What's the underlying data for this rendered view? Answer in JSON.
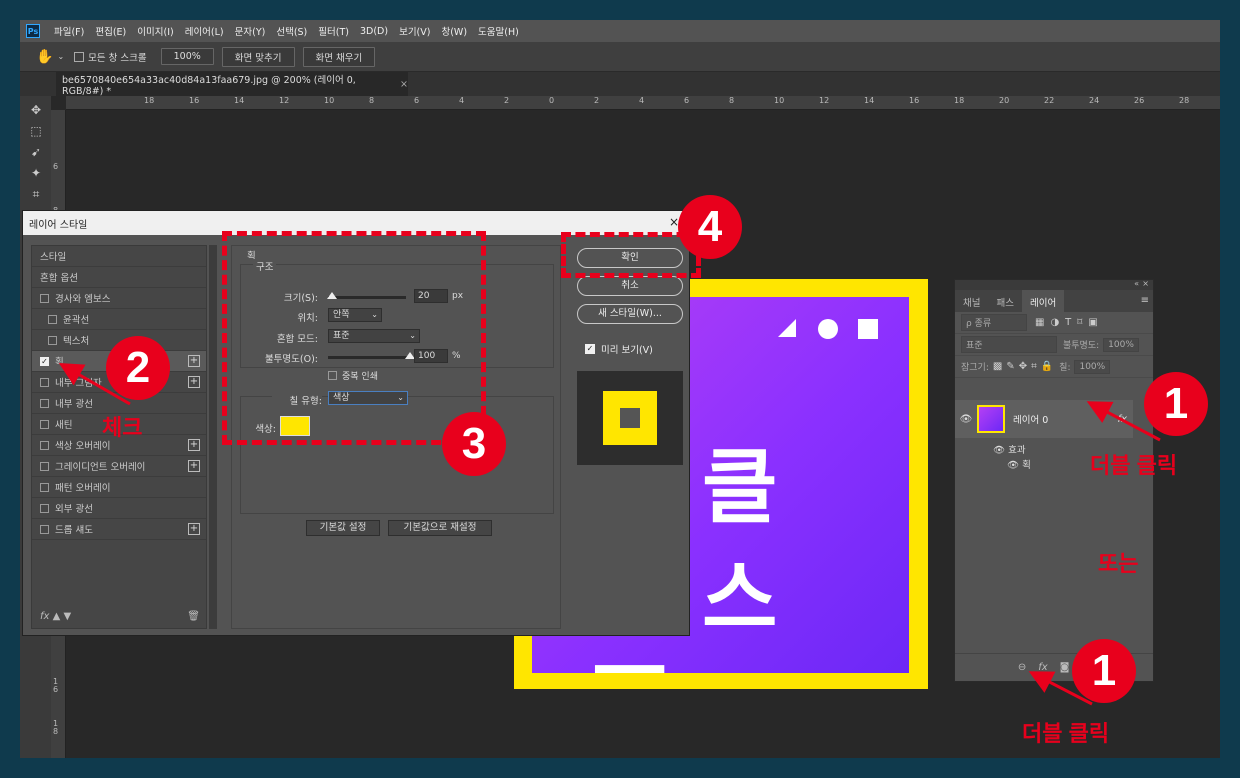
{
  "menu": {
    "logo": "Ps",
    "items": [
      "파일(F)",
      "편집(E)",
      "이미지(I)",
      "레이어(L)",
      "문자(Y)",
      "선택(S)",
      "필터(T)",
      "3D(D)",
      "보기(V)",
      "창(W)",
      "도움말(H)"
    ]
  },
  "options": {
    "scroll_all_label": "모든 창 스크롤",
    "zoom_btn": "100%",
    "fit_screen_btn": "화면 맞추기",
    "fill_screen_btn": "화면 채우기"
  },
  "document": {
    "tab_title": "be6570840e654a33ac40d84a13faa679.jpg @ 200% (레이어 0, RGB/8#) *",
    "close": "×"
  },
  "rulers": {
    "top": [
      "18",
      "16",
      "14",
      "12",
      "10",
      "8",
      "6",
      "4",
      "2",
      "0",
      "2",
      "4",
      "6",
      "8",
      "10",
      "12",
      "14",
      "16",
      "18",
      "20",
      "22",
      "24",
      "26",
      "28",
      "30"
    ],
    "left": [
      "6",
      "8",
      "1\n6",
      "1\n8"
    ]
  },
  "poster": {
    "line1": "클",
    "line2": "스",
    "line3": "ㅠ"
  },
  "layers_panel": {
    "tabs": [
      "채널",
      "패스",
      "레이어"
    ],
    "kind_filter": "ρ 종류",
    "blend_mode": "표준",
    "opacity_label": "불투명도:",
    "opacity_value": "100%",
    "lock_label": "잠그기:",
    "fill_label": "칠:",
    "fill_value": "100%",
    "layer_name": "레이어 0",
    "fx": "fx",
    "effects_label": "효과",
    "stroke_label": "획"
  },
  "dialog": {
    "title": "레이어 스타일",
    "close": "×",
    "styles": [
      {
        "label": "스타일",
        "checkbox": false,
        "plus": false,
        "indent": false,
        "active": false,
        "checked": false
      },
      {
        "label": "혼합 옵션",
        "checkbox": false,
        "plus": false,
        "indent": false,
        "active": false,
        "checked": false
      },
      {
        "label": "경사와 엠보스",
        "checkbox": true,
        "plus": false,
        "indent": false,
        "active": false,
        "checked": false
      },
      {
        "label": "윤곽선",
        "checkbox": true,
        "plus": false,
        "indent": true,
        "active": false,
        "checked": false
      },
      {
        "label": "텍스처",
        "checkbox": true,
        "plus": false,
        "indent": true,
        "active": false,
        "checked": false
      },
      {
        "label": "획",
        "checkbox": true,
        "plus": true,
        "indent": false,
        "active": true,
        "checked": true
      },
      {
        "label": "내부 그림자",
        "checkbox": true,
        "plus": true,
        "indent": false,
        "active": false,
        "checked": false
      },
      {
        "label": "내부 광선",
        "checkbox": true,
        "plus": false,
        "indent": false,
        "active": false,
        "checked": false
      },
      {
        "label": "새틴",
        "checkbox": true,
        "plus": false,
        "indent": false,
        "active": false,
        "checked": false
      },
      {
        "label": "색상 오버레이",
        "checkbox": true,
        "plus": true,
        "indent": false,
        "active": false,
        "checked": false
      },
      {
        "label": "그레이디언트 오버레이",
        "checkbox": true,
        "plus": true,
        "indent": false,
        "active": false,
        "checked": false
      },
      {
        "label": "패턴 오버레이",
        "checkbox": true,
        "plus": false,
        "indent": false,
        "active": false,
        "checked": false
      },
      {
        "label": "외부 광선",
        "checkbox": true,
        "plus": false,
        "indent": false,
        "active": false,
        "checked": false
      },
      {
        "label": "드롭 섀도",
        "checkbox": true,
        "plus": true,
        "indent": false,
        "active": false,
        "checked": false
      }
    ],
    "footer_fx": "fx",
    "stroke": {
      "section": "획",
      "structure": "구조",
      "size_label": "크기(S):",
      "size_value": "20",
      "size_unit": "px",
      "position_label": "위치:",
      "position_value": "안쪽",
      "blend_label": "혼합 모드:",
      "blend_value": "표준",
      "opacity_label": "불투명도(O):",
      "opacity_value": "100",
      "opacity_unit": "%",
      "overprint_label": "중복 인쇄",
      "fill_type_label": "칠 유형:",
      "fill_type_value": "색상",
      "color_label": "색상:",
      "color_value": "#ffe600",
      "size_fraction": 0.05,
      "opacity_fraction": 1.0
    },
    "default_btn": "기본값 설정",
    "reset_btn": "기본값으로 재설정",
    "ok_btn": "확인",
    "cancel_btn": "취소",
    "new_style_btn": "새 스타일(W)...",
    "preview_label": "미리 보기(V)",
    "preview_checked": true
  },
  "annotations": {
    "n1": "1",
    "n2": "2",
    "n3": "3",
    "n4": "4",
    "check": "체크",
    "double_click": "더블 클릭",
    "or": "또는",
    "accent": "#e8001c"
  }
}
